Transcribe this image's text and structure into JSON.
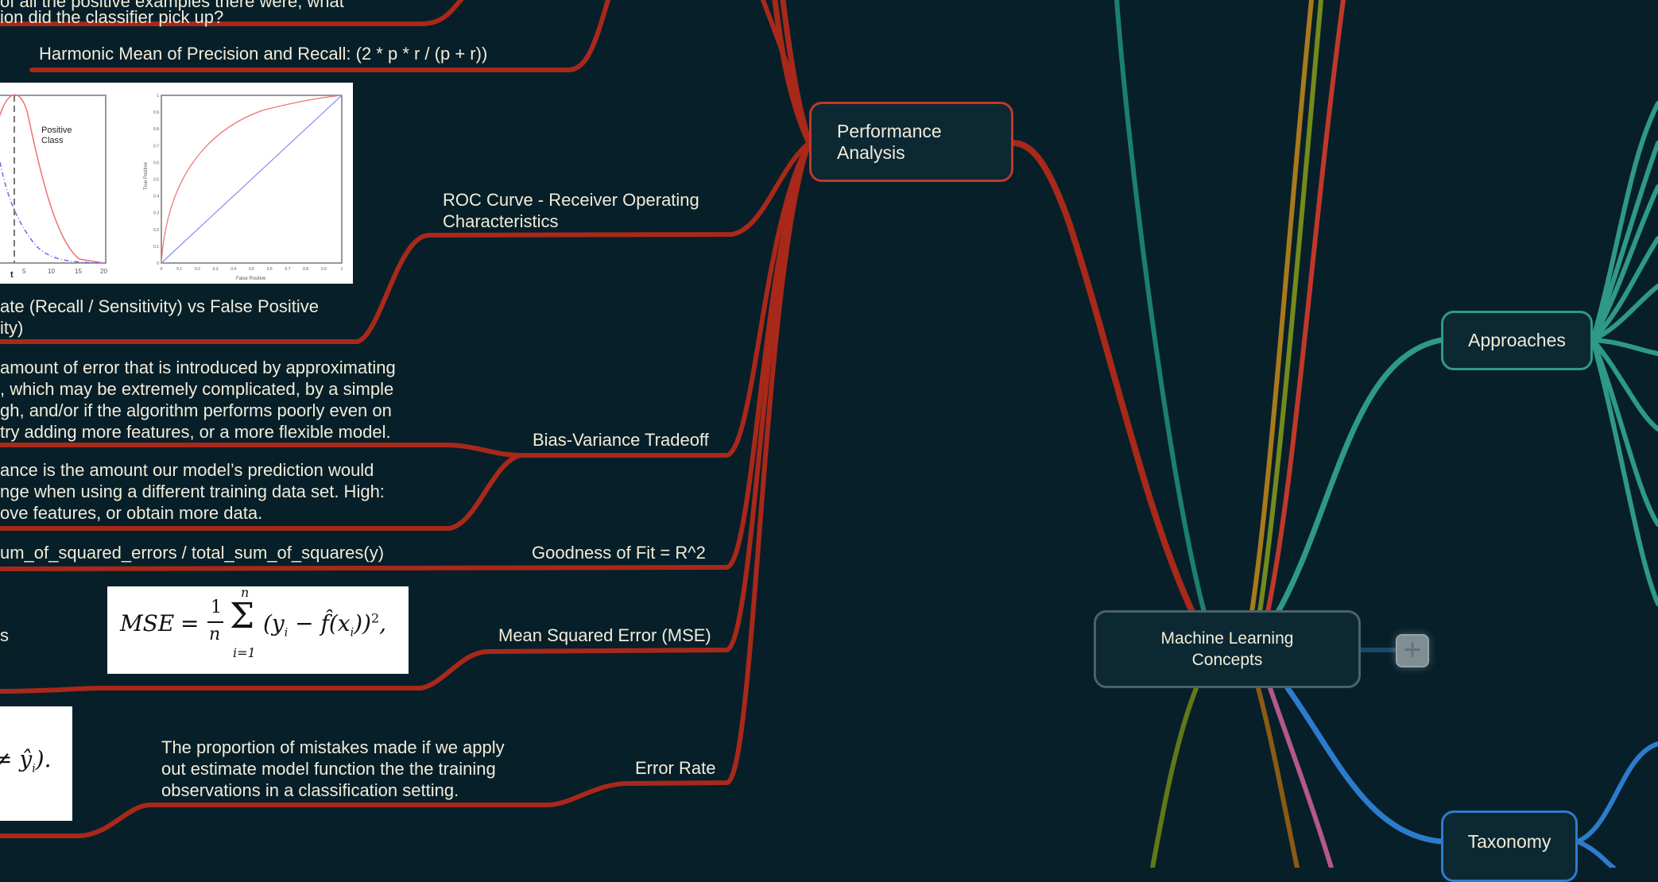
{
  "central_topic": {
    "label": "Machine Learning Concepts",
    "line1": "Machine Learning",
    "line2": "Concepts",
    "expand_button": "+",
    "expand_icon": "plus-icon"
  },
  "main_topics": [
    {
      "id": "performance",
      "line1": "Performance",
      "line2": "Analysis",
      "color": "#c0382a"
    },
    {
      "id": "approaches",
      "label": "Approaches",
      "color": "#2f9989"
    },
    {
      "id": "taxonomy",
      "label": "Taxonomy",
      "color": "#2d7ccc"
    }
  ],
  "performance_subtopics": {
    "recall_desc": {
      "line1": "Of all the positive examples there were, what",
      "line2": "fraction did the classifier pick up?",
      "line1_visible": "of all the positive examples there were, what",
      "line2_visible": "ion did the classifier pick up?"
    },
    "f1_desc": "Harmonic Mean of Precision and Recall: (2 * p * r / (p + r))",
    "roc": {
      "label_line1": "ROC Curve - Receiver Operating",
      "label_line2": "Characteristics",
      "desc_line1": "ate (Recall / Sensitivity) vs False Positive",
      "desc_line2": "ity)",
      "image": {
        "left_chart": {
          "annotation_line1": "Positive",
          "annotation_line2": "Class",
          "threshold_label": "t",
          "x_ticks": [
            "5",
            "10",
            "15",
            "20"
          ]
        },
        "right_chart": {
          "ylabel": "True Positive",
          "xlabel": "False Positive",
          "y_ticks": [
            "0",
            "0.1",
            "0.2",
            "0.3",
            "0.4",
            "0.5",
            "0.6",
            "0.7",
            "0.8",
            "0.9",
            "1"
          ],
          "x_ticks": [
            "0",
            "0.1",
            "0.2",
            "0.3",
            "0.4",
            "0.5",
            "0.6",
            "0.7",
            "0.8",
            "0.9",
            "1"
          ]
        }
      }
    },
    "bias_variance": {
      "label": "Bias-Variance Tradeoff",
      "bias_desc": [
        "amount of error that is introduced by approximating",
        ", which may be extremely complicated, by a simple",
        "gh, and/or if the algorithm performs poorly even on",
        " try adding more features, or a more flexible model."
      ],
      "variance_desc": [
        "ance is the amount our model’s prediction would",
        "nge when using a different training data set. High:",
        "ove features, or obtain more data."
      ]
    },
    "goodness_of_fit": {
      "label": "Goodness of Fit = R^2",
      "desc": "um_of_squared_errors / total_sum_of_squares(y)"
    },
    "mse": {
      "label": "Mean Squared Error (MSE)",
      "left_fragment": "s",
      "formula": {
        "lhs": "MSE",
        "eq": "=",
        "frac_num": "1",
        "frac_den": "n",
        "sum_top": "n",
        "sum_bottom": "i=1",
        "body": "(y",
        "sub_i": "i",
        "minus": " − ",
        "fhat": "f̂",
        "arg": "(x",
        "sub_i2": "i",
        "close": "))",
        "power": "2",
        "tail": ","
      }
    },
    "error_rate": {
      "label": "Error Rate",
      "desc": [
        "The proportion of mistakes made if we apply",
        "out estimate model function the the training",
        "observations in a classification setting."
      ],
      "formula_fragment": "≠ ŷ",
      "formula_sub": "i",
      "formula_tail": ")."
    }
  },
  "colors": {
    "background": "#071f29",
    "node_fill": "#0c2833",
    "text": "#f1ecd9",
    "performance_branch": "#a8281a",
    "approaches_branch": "#2f9989",
    "taxonomy_branch": "#2d7ccc",
    "other_branches": [
      "#1c7f6f",
      "#a87a1c",
      "#748a1c",
      "#c0382a",
      "#617818",
      "#8b5a14",
      "#b4588a"
    ]
  }
}
